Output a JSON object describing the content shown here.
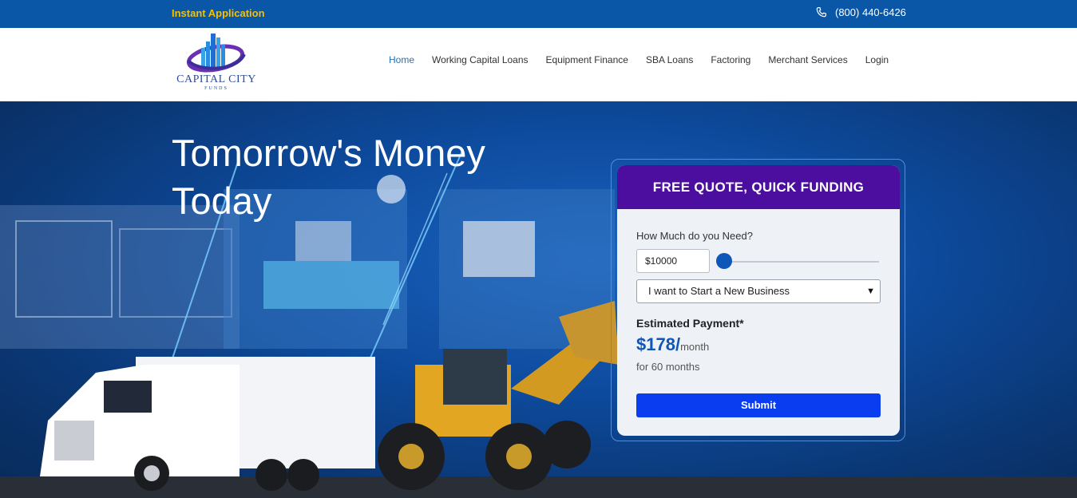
{
  "topbar": {
    "instant_label": "Instant Application",
    "phone": "(800) 440-6426"
  },
  "logo": {
    "name": "CAPITAL CITY",
    "sub": "FUNDS"
  },
  "nav": {
    "items": [
      {
        "label": "Home",
        "active": true
      },
      {
        "label": "Working Capital Loans"
      },
      {
        "label": "Equipment Finance"
      },
      {
        "label": "SBA Loans"
      },
      {
        "label": "Factoring"
      },
      {
        "label": "Merchant Services"
      },
      {
        "label": "Login"
      }
    ]
  },
  "hero": {
    "title_line1": "Tomorrow's Money",
    "title_line2": "Today"
  },
  "quote_form": {
    "header": "FREE QUOTE, QUICK FUNDING",
    "amount_label": "How Much do you Need?",
    "amount_value": "$10000",
    "slider_fraction": 0.0,
    "purpose_selected": "I want to Start a New Business",
    "estimate_label": "Estimated Payment*",
    "estimate_value": "$178/",
    "estimate_unit": "month",
    "estimate_term": "for 60 months",
    "submit_label": "Submit"
  },
  "colors": {
    "topbar": "#0a57a8",
    "instant_link": "#f5c000",
    "form_header": "#4b0e9e",
    "submit": "#0a3cf0",
    "accent": "#0e56b8"
  }
}
